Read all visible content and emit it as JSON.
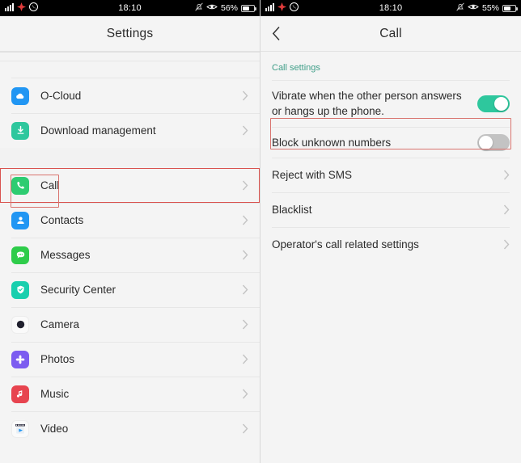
{
  "left": {
    "statusbar": {
      "signal_icon": "signal-bars-icon",
      "app_icon_1": "red-app-icon",
      "app_icon_2": "whatsapp-icon",
      "clock": "18:10",
      "mute_icon": "bell-mute-icon",
      "eye_icon": "eye-icon",
      "battery_percent": "56%",
      "battery_icon": "battery-icon"
    },
    "nav": {
      "title": "Settings"
    },
    "items": [
      {
        "label": "O-Cloud",
        "icon": "cloud-icon",
        "bg": "#2196f3",
        "glyph": "☁",
        "highlighted": false
      },
      {
        "label": "Download management",
        "icon": "download-icon",
        "bg": "#2ec79d",
        "glyph": "⬇",
        "highlighted": false
      },
      {
        "label": "Call",
        "icon": "phone-icon",
        "bg": "#2ecc71",
        "glyph": "✆",
        "highlighted": true
      },
      {
        "label": "Contacts",
        "icon": "contacts-icon",
        "bg": "#2196f3",
        "glyph": "👤",
        "highlighted": false
      },
      {
        "label": "Messages",
        "icon": "messages-icon",
        "bg": "#2ecc4a",
        "glyph": "💬",
        "highlighted": false
      },
      {
        "label": "Security Center",
        "icon": "shield-icon",
        "bg": "#19cfae",
        "glyph": "✔",
        "highlighted": false
      },
      {
        "label": "Camera",
        "icon": "camera-icon",
        "bg": "#ffffff",
        "glyph": "●",
        "highlighted": false
      },
      {
        "label": "Photos",
        "icon": "photos-icon",
        "bg": "#7c5cf0",
        "glyph": "❀",
        "highlighted": false
      },
      {
        "label": "Music",
        "icon": "music-icon",
        "bg": "#e7444f",
        "glyph": "♪",
        "highlighted": false
      },
      {
        "label": "Video",
        "icon": "video-icon",
        "bg": "#ffffff",
        "glyph": "▶",
        "highlighted": false
      }
    ],
    "chevron": "chevron-right-icon"
  },
  "right": {
    "statusbar": {
      "signal_icon": "signal-bars-icon",
      "app_icon_1": "red-app-icon",
      "app_icon_2": "whatsapp-icon",
      "clock": "18:10",
      "mute_icon": "bell-mute-icon",
      "eye_icon": "eye-icon",
      "battery_percent": "55%",
      "battery_icon": "battery-icon"
    },
    "nav": {
      "title": "Call",
      "back_icon": "chevron-left-icon"
    },
    "section_title": "Call settings",
    "rows": [
      {
        "label": "Vibrate when the other person answers or hangs up the phone.",
        "type": "toggle",
        "state": "on",
        "highlighted": false
      },
      {
        "label": "Block unknown numbers",
        "type": "toggle",
        "state": "off",
        "highlighted": true
      },
      {
        "label": "Reject with SMS",
        "type": "chevron",
        "highlighted": false
      },
      {
        "label": "Blacklist",
        "type": "chevron",
        "highlighted": false
      },
      {
        "label": "Operator's call related settings",
        "type": "chevron",
        "highlighted": false
      }
    ],
    "chevron": "chevron-right-icon"
  },
  "colors": {
    "accent_teal": "#3f9e88",
    "toggle_on": "#2ec79d",
    "toggle_off": "#c3c3c3",
    "highlight_red": "#d9534f",
    "page_bg": "#f4f4f4"
  }
}
